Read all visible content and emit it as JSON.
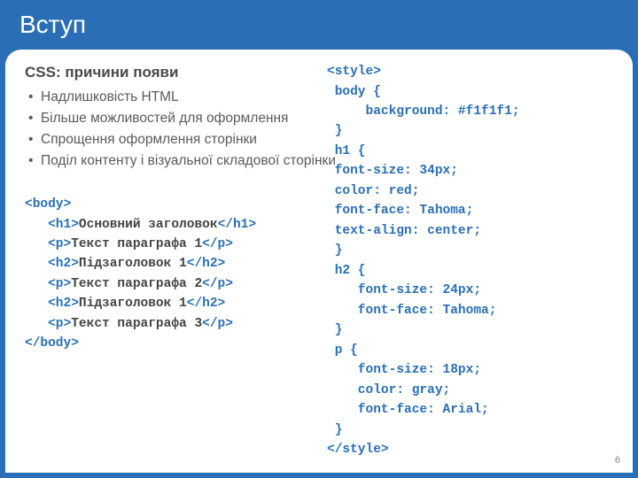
{
  "title": "Вступ",
  "heading": "CSS: причини появи",
  "bullets": [
    "Надлишковість HTML",
    "Більше можливостей для оформлення",
    "Спрощення оформлення сторінки",
    "Поділ контенту і візуальної складової сторінки"
  ],
  "code_left": {
    "l0a": "<body>",
    "l1a": "   <h1>",
    "l1b": "Основний заголовок",
    "l1c": "</h1>",
    "l2a": "   <p>",
    "l2b": "Текст параграфа 1",
    "l2c": "</p>",
    "l3a": "   <h2>",
    "l3b": "Підзаголовок 1",
    "l3c": "</h2>",
    "l4a": "   <p>",
    "l4b": "Текст параграфа 2",
    "l4c": "</p>",
    "l5a": "   <h2>",
    "l5b": "Підзаголовок 1",
    "l5c": "</h2>",
    "l6a": "   <p>",
    "l6b": "Текст параграфа 3",
    "l6c": "</p>",
    "l7a": "</body>"
  },
  "code_right": {
    "r0": "<style>",
    "r1": " body {",
    "r2": "     background: #f1f1f1;",
    "r3": " }",
    "r4": " h1 {",
    "r5": " font-size: 34px;",
    "r6": " color: red;",
    "r7": " font-face: Tahoma;",
    "r8": " text-align: center;",
    "r9": " }",
    "r10": " h2 {",
    "r11": "    font-size: 24px;",
    "r12": "    font-face: Tahoma;",
    "r13": " }",
    "r14": " p {",
    "r15": "    font-size: 18px;",
    "r16": "    color: gray;",
    "r17": "    font-face: Arial;",
    "r18": " }",
    "r19": "</style>"
  },
  "page_number": "6"
}
